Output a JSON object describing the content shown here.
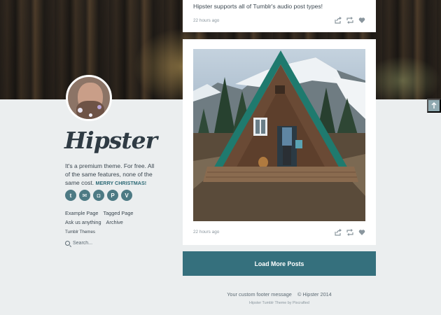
{
  "sidebar": {
    "logo": "Hipster",
    "bio_text": "It's a premium theme. For free. All of the same features, none of the same cost.",
    "bio_highlight": "MERRY CHRISTMAS!",
    "social_icons": [
      "twitter-icon",
      "mail-icon",
      "instagram-icon",
      "pinterest-icon",
      "vine-icon"
    ],
    "social_glyphs": [
      "t",
      "✉",
      "◘",
      "P",
      "V"
    ],
    "links": [
      "Example Page",
      "Tagged Page",
      "Ask us anything",
      "Archive"
    ],
    "tumblr_themes": "Tumblr Themes",
    "search_placeholder": "Search..."
  },
  "posts": [
    {
      "title": "Hipster supports all of Tumblr's audio post types!",
      "time": "22 hours ago"
    },
    {
      "time": "22 hours ago"
    }
  ],
  "post_actions": [
    "share-icon",
    "reblog-icon",
    "like-icon"
  ],
  "load_more": "Load More Posts",
  "footer": {
    "message": "Your custom footer message",
    "copyright": "© Hipster 2014",
    "credit": "Hipster Tumblr Theme by Pixcrafted"
  },
  "colors": {
    "accent": "#35707d",
    "background": "#ebeeef",
    "text": "#3b4750"
  }
}
